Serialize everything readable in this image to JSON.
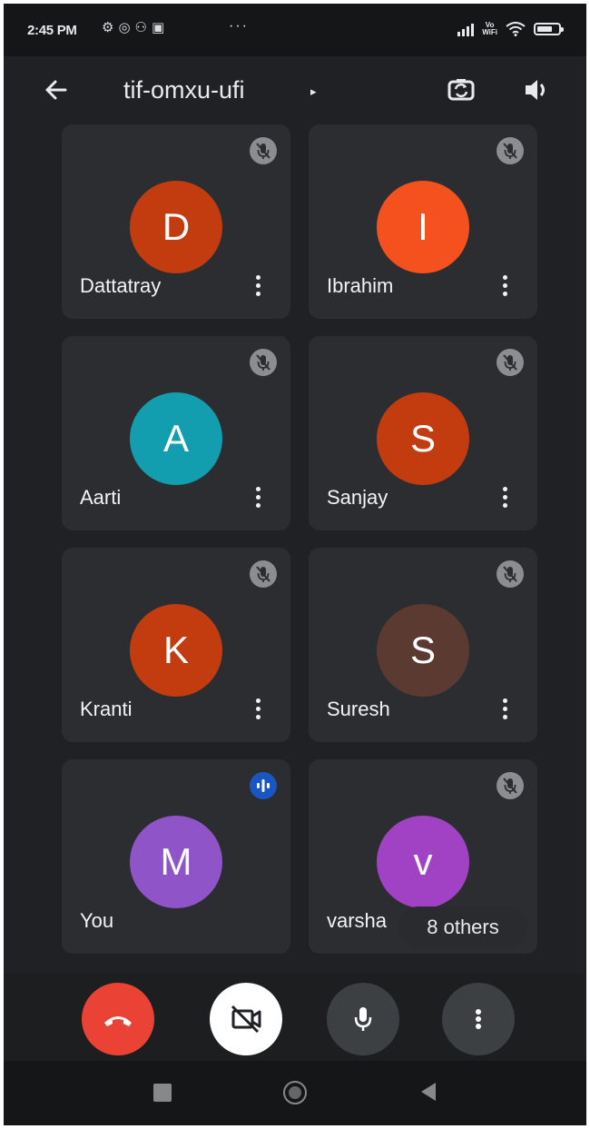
{
  "status_bar": {
    "time": "2:45 PM",
    "notification_icons": [
      "mute-icon",
      "whatsapp-icon",
      "contacts-icon",
      "message-icon"
    ],
    "more_dots": "···",
    "volte_label": "Vo WiFi"
  },
  "app_bar": {
    "meeting_code": "tif-omxu-ufi",
    "caret": "▸"
  },
  "participants": [
    {
      "name": "Dattatray",
      "initial": "D",
      "color": "#c23c0f",
      "status": "muted"
    },
    {
      "name": "Ibrahim",
      "initial": "I",
      "color": "#f4511e",
      "status": "muted"
    },
    {
      "name": "Aarti",
      "initial": "A",
      "color": "#129eaf",
      "status": "muted"
    },
    {
      "name": "Sanjay",
      "initial": "S",
      "color": "#c23c0f",
      "status": "muted"
    },
    {
      "name": "Kranti",
      "initial": "K",
      "color": "#c23c0f",
      "status": "muted"
    },
    {
      "name": "Suresh",
      "initial": "S",
      "color": "#5b3a31",
      "status": "muted"
    },
    {
      "name": "You",
      "initial": "M",
      "color": "#8e54c8",
      "status": "speaking"
    },
    {
      "name": "varsha",
      "initial": "v",
      "color": "#a142c4",
      "status": "muted"
    }
  ],
  "others_chip": "8 others",
  "controls": {
    "hangup_color": "#ea4335",
    "camera_state": "off",
    "mic_state": "on"
  }
}
